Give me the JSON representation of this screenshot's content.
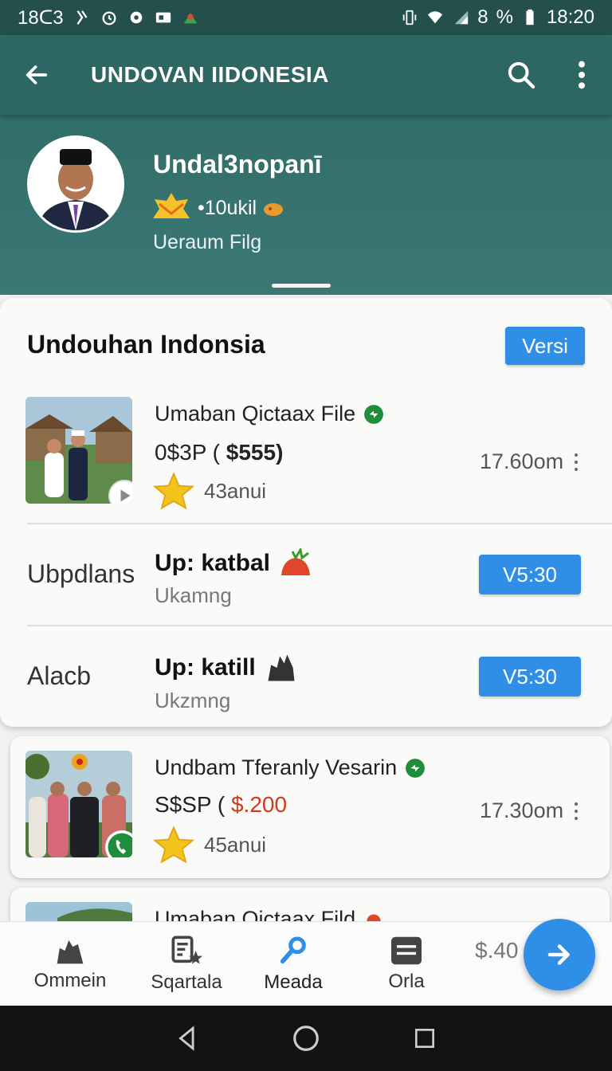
{
  "status_bar": {
    "left_time": "18ᑕ3",
    "battery_percent": "%",
    "signal_text": "8",
    "clock": "18:20"
  },
  "app_bar": {
    "title": "UNDOVAN IIDONESIA"
  },
  "profile": {
    "name": "Undal3nopanī",
    "meta": "•10ukil",
    "subtitle": "Ueraum Filg"
  },
  "section": {
    "title": "Undouhan Indonsia",
    "action_label": "Versi"
  },
  "featured_item": {
    "title": "Umaban Qictaax File",
    "price_prefix": "0$3P (",
    "price_value": "$555)",
    "rating_text": "43anui",
    "size": "17.60om"
  },
  "update_rows": [
    {
      "left_label": "Ubpdlans",
      "title": "Up: katbal",
      "subtitle": "Ukamng",
      "button": "V5:30"
    },
    {
      "left_label": "Alacb",
      "title": "Up: katill",
      "subtitle": "Ukzmng",
      "button": "V5:30"
    }
  ],
  "second_item": {
    "title": "Undbam Tferanly Vesarin",
    "price_prefix": "S$SP (",
    "price_value": "$.200",
    "rating_text": "45anui",
    "size": "17.30om"
  },
  "third_item": {
    "title": "Umaban Qictaax Fild"
  },
  "bottom_nav": {
    "items": [
      {
        "label": "Ommein",
        "icon": "home-icon"
      },
      {
        "label": "Sqartala",
        "icon": "document-star-icon"
      },
      {
        "label": "Meada",
        "icon": "key-icon"
      },
      {
        "label": "Orla",
        "icon": "menu-card-icon"
      }
    ],
    "price_text": "$.40"
  },
  "colors": {
    "app_bar": "#2d6663",
    "accent_blue": "#2f8ee5",
    "verified_green": "#1f8e3a",
    "price_red": "#d03a1a"
  }
}
